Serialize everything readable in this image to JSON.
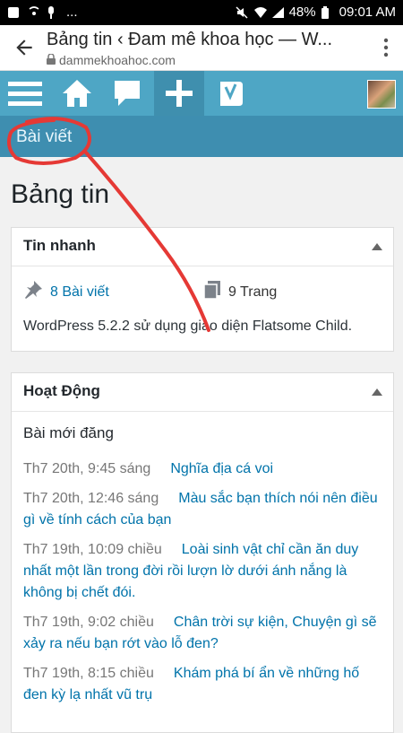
{
  "status_bar": {
    "battery": "48%",
    "time": "09:01 AM",
    "dots": "..."
  },
  "browser": {
    "title": "Bảng tin ‹ Đam mê khoa học — W...",
    "url": "dammekhoahoc.com"
  },
  "submenu": {
    "label": "Bài viết"
  },
  "page": {
    "title": "Bảng tin"
  },
  "tin_nhanh": {
    "title": "Tin nhanh",
    "posts": "8 Bài viết",
    "pages": "9 Trang",
    "description": "WordPress 5.2.2 sử dụng giao diện Flatsome Child."
  },
  "hoat_dong": {
    "title": "Hoạt Động",
    "subtitle": "Bài mới đăng",
    "items": [
      {
        "date": "Th7 20th, 9:45 sáng",
        "title": "Nghĩa địa cá voi"
      },
      {
        "date": "Th7 20th, 12:46 sáng",
        "title": "Màu sắc bạn thích nói nên điều gì về tính cách của bạn"
      },
      {
        "date": "Th7 19th, 10:09 chiều",
        "title": "Loài sinh vật chỉ cần ăn duy nhất một lần trong đời rồi lượn lờ dưới ánh nắng là không bị chết đói."
      },
      {
        "date": "Th7 19th, 9:02 chiều",
        "title": "Chân trời sự kiện, Chuyện gì sẽ xảy ra nếu bạn rớt vào lỗ đen?"
      },
      {
        "date": "Th7 19th, 8:15 chiều",
        "title": "Khám phá bí ẩn về những hố đen kỳ lạ nhất vũ trụ"
      }
    ]
  }
}
